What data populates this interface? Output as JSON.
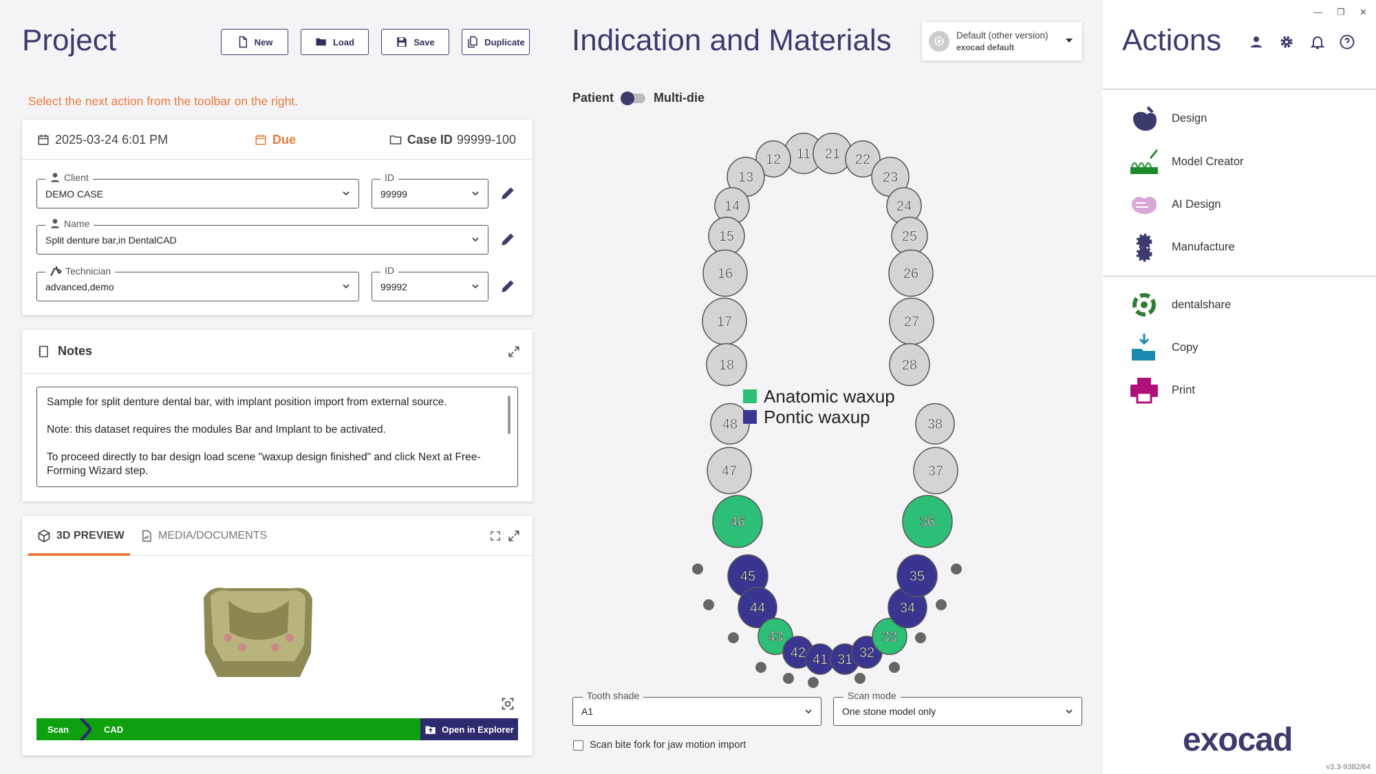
{
  "project": {
    "title": "Project",
    "buttons": {
      "new": "New",
      "load": "Load",
      "save": "Save",
      "duplicate": "Duplicate"
    },
    "hint": "Select the next action from the toolbar on the right.",
    "info": {
      "datetime": "2025-03-24 6:01 PM",
      "due": "Due",
      "case_label": "Case ID",
      "case_value": "99999-100"
    },
    "client": {
      "label": "Client",
      "value": "DEMO CASE",
      "id_label": "ID",
      "id_value": "99999"
    },
    "name": {
      "label": "Name",
      "value": "Split denture bar,in DentalCAD"
    },
    "technician": {
      "label": "Technician",
      "value": "advanced,demo",
      "id_label": "ID",
      "id_value": "99992"
    }
  },
  "notes": {
    "title": "Notes",
    "lines": [
      "Sample for split denture dental bar, with implant position import from external source.",
      "Note: this dataset requires the modules Bar and Implant to be activated.",
      "To proceed directly to bar design load scene \"waxup design finished\" and click Next at Free-Forming Wizard step."
    ]
  },
  "preview": {
    "tabs": [
      "3D PREVIEW",
      "MEDIA/DOCUMENTS"
    ],
    "pipeline": {
      "scan": "Scan",
      "cad": "CAD"
    },
    "open_explorer": "Open in Explorer"
  },
  "indication": {
    "title": "Indication and Materials",
    "version": {
      "main": "Default (other version)",
      "sub": "exocad default"
    },
    "toggle_left": "Patient",
    "toggle_right": "Multi-die",
    "legend": [
      {
        "label": "Anatomic waxup",
        "color": "#2dbf75"
      },
      {
        "label": "Pontic waxup",
        "color": "#3a3591"
      }
    ],
    "tooth_shade": {
      "label": "Tooth shade",
      "value": "A1"
    },
    "scan_mode": {
      "label": "Scan mode",
      "value": "One stone model only"
    },
    "bite_fork": "Scan bite fork for jaw motion import"
  },
  "teeth": {
    "colors": {
      "none": "#d4d4d4",
      "anatomic": "#2dbf75",
      "pontic": "#3a3591"
    },
    "list": [
      {
        "n": "11",
        "state": "none"
      },
      {
        "n": "12",
        "state": "none"
      },
      {
        "n": "13",
        "state": "none"
      },
      {
        "n": "14",
        "state": "none"
      },
      {
        "n": "15",
        "state": "none"
      },
      {
        "n": "16",
        "state": "none"
      },
      {
        "n": "17",
        "state": "none"
      },
      {
        "n": "18",
        "state": "none"
      },
      {
        "n": "21",
        "state": "none"
      },
      {
        "n": "22",
        "state": "none"
      },
      {
        "n": "23",
        "state": "none"
      },
      {
        "n": "24",
        "state": "none"
      },
      {
        "n": "25",
        "state": "none"
      },
      {
        "n": "26",
        "state": "none"
      },
      {
        "n": "27",
        "state": "none"
      },
      {
        "n": "28",
        "state": "none"
      },
      {
        "n": "48",
        "state": "none"
      },
      {
        "n": "47",
        "state": "none"
      },
      {
        "n": "46",
        "state": "anatomic"
      },
      {
        "n": "45",
        "state": "pontic"
      },
      {
        "n": "44",
        "state": "pontic"
      },
      {
        "n": "43",
        "state": "anatomic"
      },
      {
        "n": "42",
        "state": "pontic"
      },
      {
        "n": "41",
        "state": "pontic"
      },
      {
        "n": "31",
        "state": "pontic"
      },
      {
        "n": "32",
        "state": "pontic"
      },
      {
        "n": "33",
        "state": "anatomic"
      },
      {
        "n": "34",
        "state": "pontic"
      },
      {
        "n": "35",
        "state": "pontic"
      },
      {
        "n": "36",
        "state": "anatomic"
      },
      {
        "n": "37",
        "state": "none"
      },
      {
        "n": "38",
        "state": "none"
      }
    ]
  },
  "actions": {
    "title": "Actions",
    "items": [
      {
        "label": "Design",
        "icon": "design-icon",
        "color": "#3b3b6e"
      },
      {
        "label": "Model Creator",
        "icon": "model-creator-icon",
        "color": "#1a8a2a"
      },
      {
        "label": "AI Design",
        "icon": "ai-design-icon",
        "color": "#d9a8d8"
      },
      {
        "label": "Manufacture",
        "icon": "manufacture-icon",
        "color": "#3b3b6e"
      },
      {
        "label": "dentalshare",
        "icon": "dentalshare-icon",
        "color": "#2e7d32"
      },
      {
        "label": "Copy",
        "icon": "copy-icon",
        "color": "#1a8ab0"
      },
      {
        "label": "Print",
        "icon": "print-icon",
        "color": "#b0107a"
      }
    ],
    "brand": "exocad",
    "version": "v3.3-9382/64"
  }
}
